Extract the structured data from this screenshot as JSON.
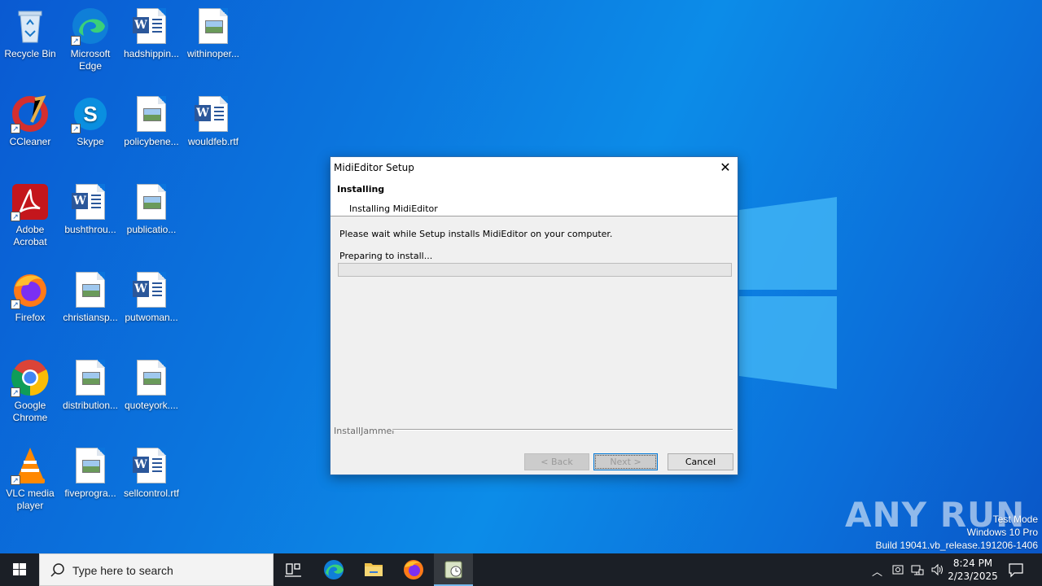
{
  "desktop": {
    "icons": [
      {
        "label": "Recycle Bin",
        "icon": "recycle-bin-icon"
      },
      {
        "label": "Microsoft Edge",
        "icon": "edge-icon"
      },
      {
        "label": "hadshippin...",
        "icon": "word-doc-icon"
      },
      {
        "label": "withinoper...",
        "icon": "image-doc-icon"
      },
      {
        "label": "CCleaner",
        "icon": "ccleaner-icon"
      },
      {
        "label": "Skype",
        "icon": "skype-icon"
      },
      {
        "label": "policybene...",
        "icon": "image-doc-icon"
      },
      {
        "label": "wouldfeb.rtf",
        "icon": "word-doc-icon"
      },
      {
        "label": "Adobe Acrobat",
        "icon": "acrobat-icon"
      },
      {
        "label": "bushthrou...",
        "icon": "word-doc-icon"
      },
      {
        "label": "publicatio...",
        "icon": "image-doc-icon"
      },
      {
        "label": "Firefox",
        "icon": "firefox-icon"
      },
      {
        "label": "christiansp...",
        "icon": "image-doc-icon"
      },
      {
        "label": "putwoman...",
        "icon": "word-doc-icon"
      },
      {
        "label": "Google Chrome",
        "icon": "chrome-icon"
      },
      {
        "label": "distribution...",
        "icon": "image-doc-icon"
      },
      {
        "label": "quoteyork....",
        "icon": "image-doc-icon"
      },
      {
        "label": "VLC media player",
        "icon": "vlc-icon"
      },
      {
        "label": "fiveprogra...",
        "icon": "image-doc-icon"
      },
      {
        "label": "sellcontrol.rtf",
        "icon": "word-doc-icon"
      }
    ]
  },
  "dialog": {
    "title": "MidiEditor Setup",
    "heading": "Installing",
    "subheading": "Installing MidiEditor",
    "message": "Please wait while Setup installs MidiEditor on your computer.",
    "status": "Preparing to install...",
    "progress": 0,
    "brand": "InstallJammer",
    "buttons": {
      "back": "< Back",
      "next": "Next >",
      "cancel": "Cancel"
    }
  },
  "taskbar": {
    "search_placeholder": "Type here to search",
    "time": "8:24 PM",
    "date": "2/23/2025"
  },
  "watermark": {
    "line1": "Test Mode",
    "line2": "Windows 10 Pro",
    "line3": "Build 19041.vb_release.191206-1406",
    "logo": "ANY RUN"
  },
  "colors": {
    "accent": "#0078d7",
    "taskbar": "#1b1f26",
    "progress": "#06b025"
  }
}
